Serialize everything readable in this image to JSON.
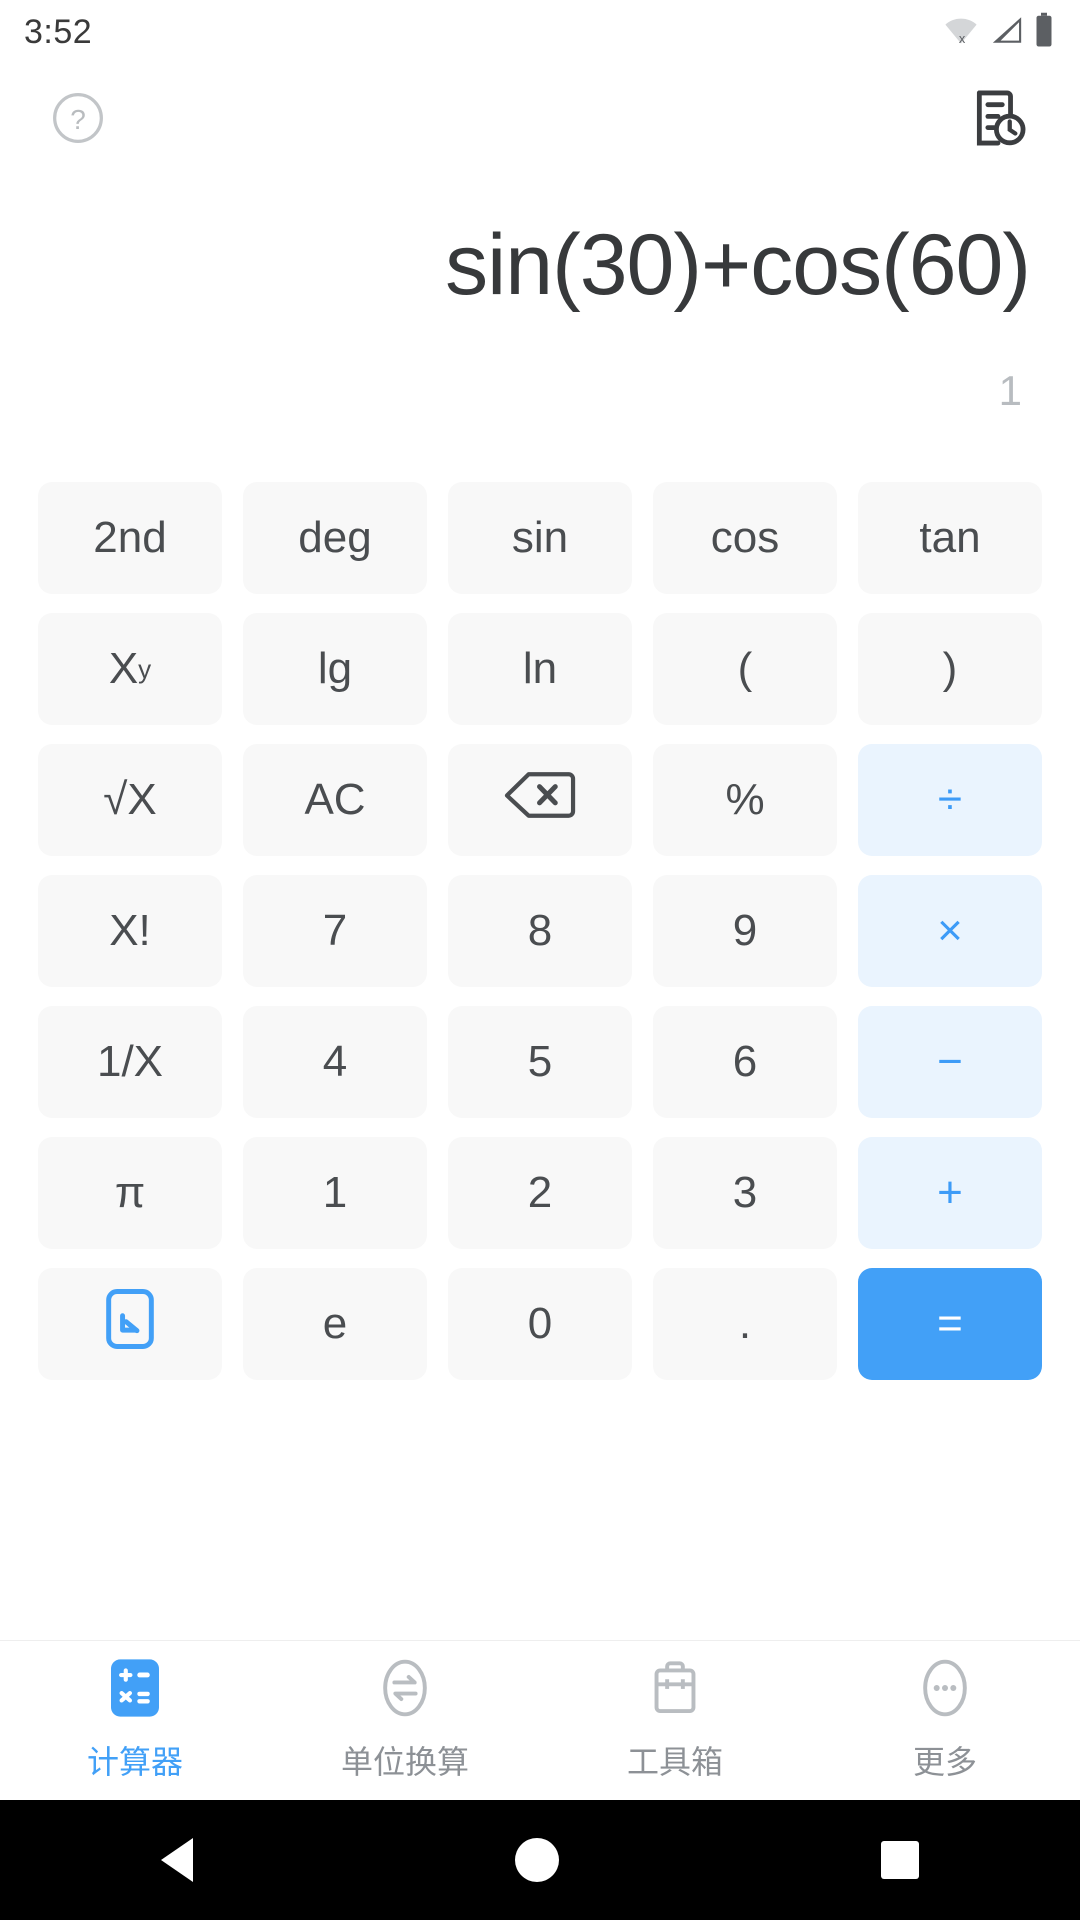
{
  "status_bar": {
    "time": "3:52",
    "icons": [
      "wifi-off-icon",
      "cellular-signal-icon",
      "battery-full-icon"
    ]
  },
  "action_bar": {
    "help_icon": "help-circle-icon",
    "history_icon": "history-document-icon"
  },
  "display": {
    "expression": "sin(30)+cos(60)",
    "result": "1"
  },
  "colors": {
    "accent": "#42a0f7",
    "operator_bg": "#eaf4fe",
    "operator_fg": "#3d9bf7",
    "key_bg": "#f8f8f8",
    "key_fg": "#4a4d50",
    "expr_fg": "#37393b",
    "result_fg": "#b8bcc0"
  },
  "keypad": {
    "rows": [
      [
        {
          "label": "2nd",
          "name": "key-2nd",
          "type": "func"
        },
        {
          "label": "deg",
          "name": "key-deg",
          "type": "func"
        },
        {
          "label": "sin",
          "name": "key-sin",
          "type": "func"
        },
        {
          "label": "cos",
          "name": "key-cos",
          "type": "func"
        },
        {
          "label": "tan",
          "name": "key-tan",
          "type": "func"
        }
      ],
      [
        {
          "label": "X",
          "sup": "y",
          "name": "key-power",
          "type": "func"
        },
        {
          "label": "lg",
          "name": "key-lg",
          "type": "func"
        },
        {
          "label": "ln",
          "name": "key-ln",
          "type": "func"
        },
        {
          "label": "(",
          "name": "key-open-paren",
          "type": "func"
        },
        {
          "label": ")",
          "name": "key-close-paren",
          "type": "func"
        }
      ],
      [
        {
          "label": "√X",
          "name": "key-sqrt",
          "type": "func"
        },
        {
          "label": "AC",
          "name": "key-all-clear",
          "type": "func"
        },
        {
          "label": "",
          "name": "key-backspace",
          "type": "icon",
          "icon": "backspace-icon"
        },
        {
          "label": "%",
          "name": "key-percent",
          "type": "func"
        },
        {
          "label": "÷",
          "name": "key-divide",
          "type": "op"
        }
      ],
      [
        {
          "label": "X!",
          "name": "key-factorial",
          "type": "func"
        },
        {
          "label": "7",
          "name": "key-7",
          "type": "digit"
        },
        {
          "label": "8",
          "name": "key-8",
          "type": "digit"
        },
        {
          "label": "9",
          "name": "key-9",
          "type": "digit"
        },
        {
          "label": "×",
          "name": "key-multiply",
          "type": "op"
        }
      ],
      [
        {
          "label": "1/X",
          "name": "key-reciprocal",
          "type": "func"
        },
        {
          "label": "4",
          "name": "key-4",
          "type": "digit"
        },
        {
          "label": "5",
          "name": "key-5",
          "type": "digit"
        },
        {
          "label": "6",
          "name": "key-6",
          "type": "digit"
        },
        {
          "label": "−",
          "name": "key-minus",
          "type": "op"
        }
      ],
      [
        {
          "label": "π",
          "name": "key-pi",
          "type": "func"
        },
        {
          "label": "1",
          "name": "key-1",
          "type": "digit"
        },
        {
          "label": "2",
          "name": "key-2",
          "type": "digit"
        },
        {
          "label": "3",
          "name": "key-3",
          "type": "digit"
        },
        {
          "label": "+",
          "name": "key-plus",
          "type": "op"
        }
      ],
      [
        {
          "label": "",
          "name": "key-collapse-keypad",
          "type": "icon",
          "icon": "collapse-arrow-icon"
        },
        {
          "label": "e",
          "name": "key-e",
          "type": "func"
        },
        {
          "label": "0",
          "name": "key-0",
          "type": "digit"
        },
        {
          "label": ".",
          "name": "key-decimal",
          "type": "digit"
        },
        {
          "label": "=",
          "name": "key-equals",
          "type": "eq"
        }
      ]
    ]
  },
  "bottom_nav": {
    "items": [
      {
        "label": "计算器",
        "name": "nav-calculator",
        "icon": "calculator-icon",
        "active": true
      },
      {
        "label": "单位换算",
        "name": "nav-unit-conversion",
        "icon": "convert-icon",
        "active": false
      },
      {
        "label": "工具箱",
        "name": "nav-toolbox",
        "icon": "toolbox-icon",
        "active": false
      },
      {
        "label": "更多",
        "name": "nav-more",
        "icon": "more-dots-icon",
        "active": false
      }
    ]
  },
  "system_nav": {
    "back": "back-triangle-icon",
    "home": "home-circle-icon",
    "recents": "recents-square-icon"
  }
}
